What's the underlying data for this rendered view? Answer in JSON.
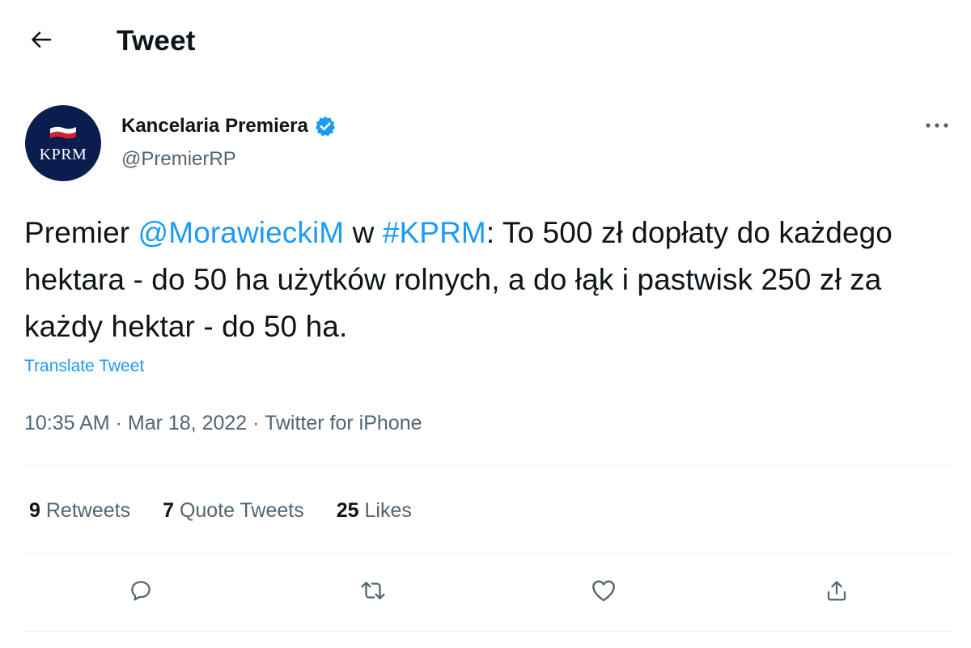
{
  "header": {
    "title": "Tweet",
    "back_icon": "arrow-left-icon"
  },
  "author": {
    "avatar_text": "KPRM",
    "display_name": "Kancelaria Premiera",
    "handle": "@PremierRP",
    "verified": true
  },
  "tweet": {
    "text_parts": {
      "p1": "Premier ",
      "mention": "@MorawieckiM",
      "p2": " w ",
      "hashtag": "#KPRM",
      "p3": ": To 500 zł dopłaty do każdego hektara - do 50 ha użytków rolnych, a do łąk i pastwisk 250 zł za każdy hektar - do 50 ha."
    },
    "translate_label": "Translate Tweet"
  },
  "meta": {
    "time": "10:35 AM",
    "date": "Mar 18, 2022",
    "separator": "·",
    "source": "Twitter for iPhone"
  },
  "stats": {
    "retweets_count": "9",
    "retweets_label": "Retweets",
    "quotes_count": "7",
    "quotes_label": "Quote Tweets",
    "likes_count": "25",
    "likes_label": "Likes"
  },
  "actions": [
    "reply-icon",
    "retweet-icon",
    "like-icon",
    "share-icon"
  ],
  "colors": {
    "accent": "#1d9bf0",
    "text": "#0f1419",
    "secondary": "#536471",
    "divider": "#eff3f4",
    "avatar_bg": "#0b1d4f"
  }
}
